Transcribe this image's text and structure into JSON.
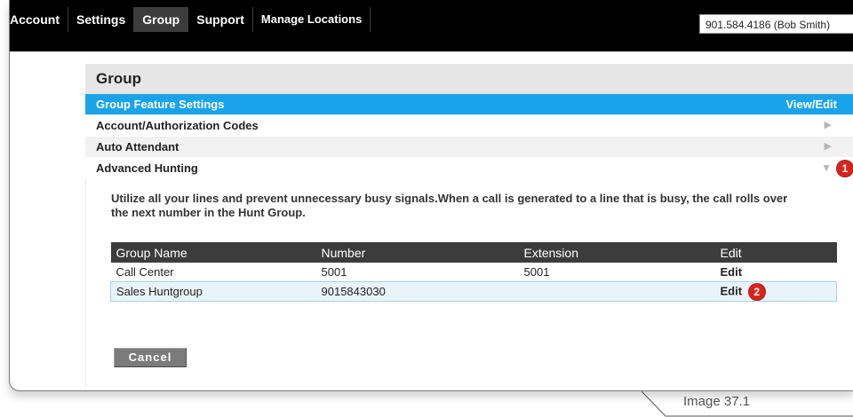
{
  "topnav": {
    "tabs": [
      {
        "label": "Account"
      },
      {
        "label": "Settings"
      },
      {
        "label": "Group"
      },
      {
        "label": "Support"
      },
      {
        "label": "Manage Locations"
      }
    ],
    "active_tab": "Group",
    "account_selector": "901.584.4186 (Bob Smith)"
  },
  "panel": {
    "title": "Group",
    "header_row": {
      "label": "Group Feature Settings",
      "action": "View/Edit"
    },
    "features": [
      {
        "label": "Account/Authorization Codes",
        "icon": "triangle-right-icon"
      },
      {
        "label": "Auto Attendant",
        "icon": "triangle-right-icon"
      },
      {
        "label": "Advanced Hunting",
        "icon": "triangle-down-icon",
        "badge": "1"
      }
    ],
    "advanced_hunting": {
      "description": "Utilize all your lines and prevent unnecessary busy signals.When a call is generated to a line that is busy, the call rolls over the next number in the Hunt Group.",
      "columns": [
        "Group Name",
        "Number",
        "Extension",
        "Edit"
      ],
      "rows": [
        {
          "group_name": "Call Center",
          "number": "5001",
          "extension": "5001",
          "edit": "Edit"
        },
        {
          "group_name": "Sales Huntgroup",
          "number": "9015843030",
          "extension": "",
          "edit": "Edit",
          "badge": "2"
        }
      ],
      "cancel_label": "Cancel"
    }
  },
  "caption": "Image 37.1",
  "colors": {
    "header_blue": "#1aa3e8",
    "nav_black": "#000000",
    "table_header": "#3c3c3c",
    "badge_red": "#d9251d",
    "selected_row": "#e9f4fa"
  }
}
